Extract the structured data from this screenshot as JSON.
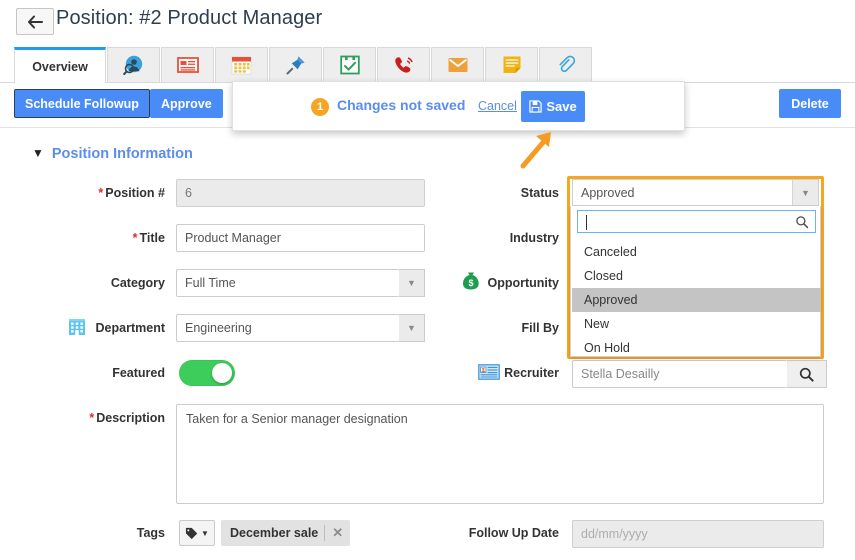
{
  "header": {
    "back_icon": "arrow-left-icon",
    "title": "Position: #2 Product Manager"
  },
  "tabs": [
    {
      "label": "Overview",
      "icon": "overview-tab",
      "active": true
    },
    {
      "label": "",
      "icon": "contacts-icon",
      "active": false
    },
    {
      "label": "",
      "icon": "news-list-icon",
      "active": false
    },
    {
      "label": "",
      "icon": "calendar-icon",
      "active": false
    },
    {
      "label": "",
      "icon": "pin-icon",
      "active": false
    },
    {
      "label": "",
      "icon": "task-check-icon",
      "active": false
    },
    {
      "label": "",
      "icon": "phone-call-icon",
      "active": false
    },
    {
      "label": "",
      "icon": "email-icon",
      "active": false
    },
    {
      "label": "",
      "icon": "notes-icon",
      "active": false
    },
    {
      "label": "",
      "icon": "attachment-icon",
      "active": false
    }
  ],
  "actionbar": {
    "schedule_followup_label": "Schedule Followup",
    "approve_label": "Approve",
    "delete_label": "Delete"
  },
  "unsaved_popup": {
    "badge_count": "1",
    "message": "Changes not saved",
    "cancel_label": "Cancel",
    "save_label": "Save",
    "save_icon": "floppy-disk-icon",
    "badge_color": "#f5a623",
    "link_color": "#5b8def"
  },
  "section": {
    "title": "Position Information",
    "collapse_icon": "chevron-down-icon"
  },
  "form": {
    "position_number": {
      "label": "Position #",
      "required": true,
      "value": "6",
      "readonly": true
    },
    "title": {
      "label": "Title",
      "required": true,
      "value": "Product Manager"
    },
    "category": {
      "label": "Category",
      "required": false,
      "value": "Full Time",
      "caret_icon": "chevron-down-icon"
    },
    "department": {
      "label": "Department",
      "required": false,
      "value": "Engineering",
      "icon": "building-icon",
      "caret_icon": "chevron-down-icon"
    },
    "featured": {
      "label": "Featured",
      "value": "on",
      "on_color": "#3ccd5b"
    },
    "status": {
      "label": "Status",
      "value": "Approved",
      "caret_icon": "chevron-down-icon",
      "highlight_color": "#f5a623"
    },
    "industry": {
      "label": "Industry",
      "value": ""
    },
    "opportunity": {
      "label": "Opportunity",
      "icon": "money-bag-icon",
      "value": ""
    },
    "fill_by": {
      "label": "Fill By",
      "value": ""
    },
    "recruiter": {
      "label": "Recruiter",
      "icon": "contact-card-icon",
      "value": "Stella Desailly",
      "search_icon": "search-icon"
    },
    "description": {
      "label": "Description",
      "required": true,
      "value": "Taken for a Senior manager designation"
    },
    "tags": {
      "label": "Tags",
      "dropdown_icon": "tag-icon",
      "caret_icon": "chevron-down-icon",
      "chips": [
        {
          "label": "December sale",
          "remove_icon": "close-icon"
        }
      ]
    },
    "follow_up_date": {
      "label": "Follow Up Date",
      "value": "",
      "placeholder": "dd/mm/yyyy"
    }
  },
  "status_dropdown": {
    "open": true,
    "search_value": "",
    "search_icon": "search-icon",
    "options": [
      {
        "label": "Canceled",
        "selected": false
      },
      {
        "label": "Closed",
        "selected": false
      },
      {
        "label": "Approved",
        "selected": true
      },
      {
        "label": "New",
        "selected": false
      },
      {
        "label": "On Hold",
        "selected": false
      }
    ]
  },
  "annotation": {
    "arrow_icon": "arrow-up-right-annotation",
    "color": "#f59a23"
  }
}
